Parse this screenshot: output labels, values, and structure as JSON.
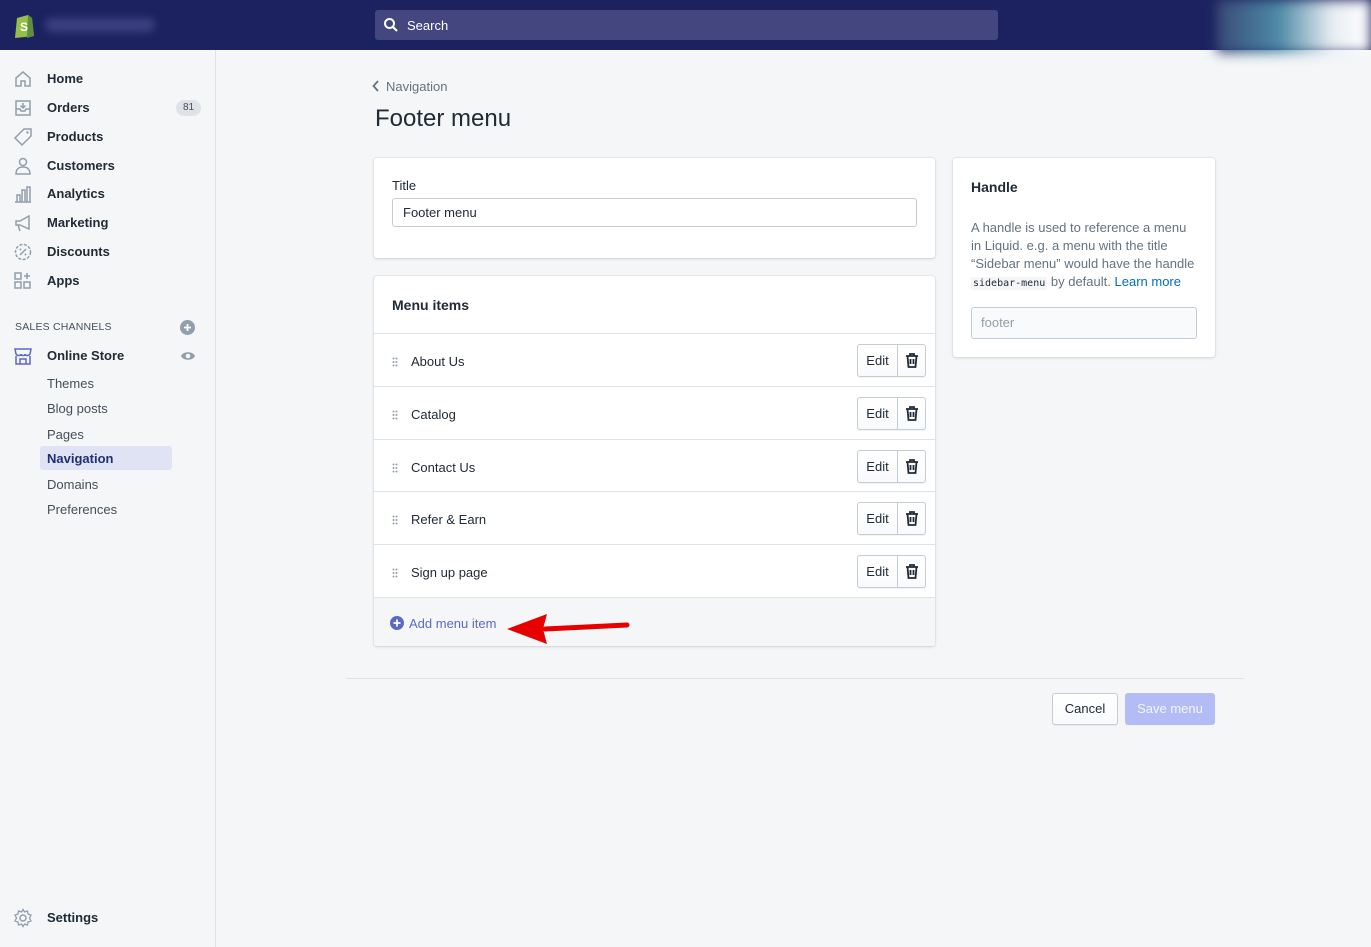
{
  "topbar": {
    "search_label": "Search"
  },
  "sidebar": {
    "items": [
      {
        "name": "home",
        "label": "Home",
        "icon": "home-icon"
      },
      {
        "name": "orders",
        "label": "Orders",
        "icon": "orders-icon",
        "badge": "81"
      },
      {
        "name": "products",
        "label": "Products",
        "icon": "tag-icon"
      },
      {
        "name": "customers",
        "label": "Customers",
        "icon": "person-icon"
      },
      {
        "name": "analytics",
        "label": "Analytics",
        "icon": "bar-chart-icon"
      },
      {
        "name": "marketing",
        "label": "Marketing",
        "icon": "megaphone-icon"
      },
      {
        "name": "discounts",
        "label": "Discounts",
        "icon": "discount-icon"
      },
      {
        "name": "apps",
        "label": "Apps",
        "icon": "apps-icon"
      }
    ],
    "sales_channels_heading": "SALES CHANNELS",
    "online_store": {
      "label": "Online Store",
      "sub_items": [
        "Themes",
        "Blog posts",
        "Pages",
        "Navigation",
        "Domains",
        "Preferences"
      ],
      "active": "Navigation"
    },
    "settings_label": "Settings"
  },
  "main": {
    "breadcrumb": "Navigation",
    "page_title": "Footer menu",
    "title_field": {
      "label": "Title",
      "value": "Footer menu"
    },
    "menu_items": {
      "heading": "Menu items",
      "items": [
        "About Us",
        "Catalog",
        "Contact Us",
        "Refer & Earn",
        "Sign up page"
      ],
      "edit_label": "Edit",
      "add_label": "Add menu item"
    },
    "handle": {
      "heading": "Handle",
      "desc_1": "A handle is used to reference a menu in Liquid. e.g. a menu with the title “Sidebar menu” would have the handle",
      "code": "sidebar-menu",
      "desc_2": "by default.",
      "learn_more": "Learn more",
      "placeholder": "footer"
    },
    "cancel_label": "Cancel",
    "save_label": "Save menu"
  },
  "colors": {
    "topbar": "#1c2260",
    "accent": "#5c6ac4",
    "save_disabled": "#b3bcf5",
    "annotation_arrow": "#e60000"
  }
}
